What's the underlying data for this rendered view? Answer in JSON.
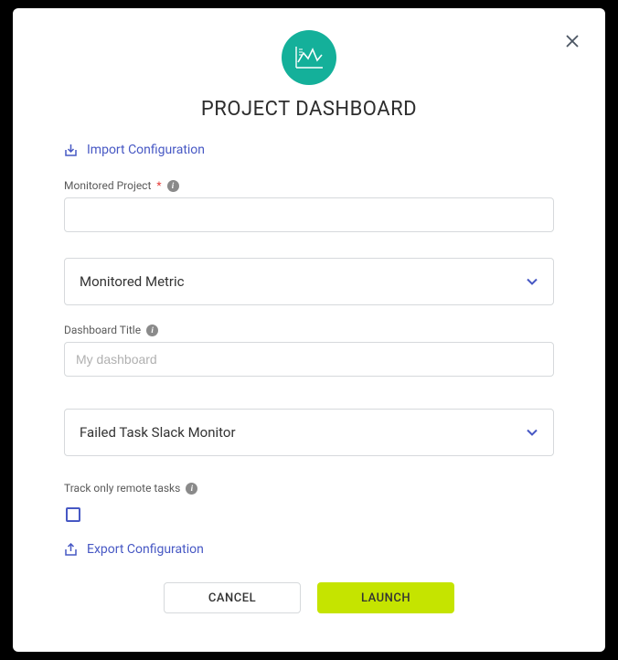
{
  "modal": {
    "title": "PROJECT DASHBOARD"
  },
  "links": {
    "import": "Import Configuration",
    "export": "Export Configuration"
  },
  "fields": {
    "monitored_project": {
      "label": "Monitored Project",
      "value": ""
    },
    "monitored_metric": {
      "label": "Monitored Metric"
    },
    "dashboard_title": {
      "label": "Dashboard Title",
      "placeholder": "My dashboard",
      "value": ""
    },
    "failed_task_monitor": {
      "label": "Failed Task Slack Monitor"
    },
    "track_remote": {
      "label": "Track only remote tasks",
      "checked": false
    }
  },
  "buttons": {
    "cancel": "CANCEL",
    "launch": "LAUNCH"
  }
}
